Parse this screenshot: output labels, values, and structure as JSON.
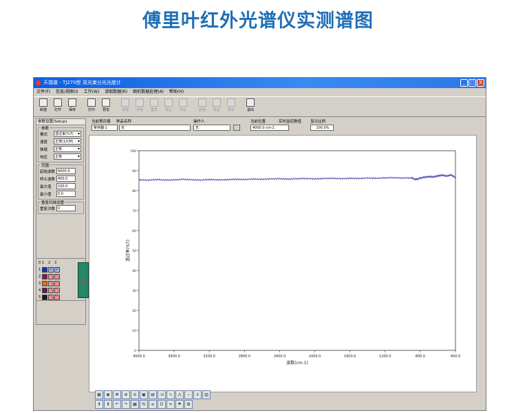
{
  "page": {
    "heading": "傅里叶红外光谱仪实测谱图"
  },
  "window": {
    "title": "天瑞谱 - TJ270型 双光束分光光度计",
    "menu": [
      "文件(F)",
      "信息/视图(I)",
      "工作(W)",
      "读取数据(R)",
      "图形数据处理(A)",
      "帮助(H)"
    ],
    "controls": [
      "_",
      "□",
      "X"
    ]
  },
  "toolbar": {
    "buttons": [
      {
        "label": "新建",
        "icon": "new-file-icon",
        "enabled": true
      },
      {
        "label": "打开",
        "icon": "open-folder-icon",
        "enabled": true
      },
      {
        "label": "保存",
        "icon": "save-icon",
        "enabled": true
      },
      {
        "label": "打印",
        "icon": "print-icon",
        "enabled": true
      },
      {
        "label": "预览",
        "icon": "preview-icon",
        "enabled": true
      },
      {
        "label": "单程",
        "icon": "single-run-icon",
        "enabled": false
      },
      {
        "label": "多程",
        "icon": "multi-run-icon",
        "enabled": false
      },
      {
        "label": "重复",
        "icon": "repeat-icon",
        "enabled": false
      },
      {
        "label": "停止",
        "icon": "stop-icon",
        "enabled": false
      },
      {
        "label": "中止",
        "icon": "abort-icon",
        "enabled": false
      },
      {
        "label": "检测",
        "icon": "detect-icon",
        "enabled": false
      },
      {
        "label": "校正",
        "icon": "calibrate-icon",
        "enabled": false
      },
      {
        "label": "复位",
        "icon": "reset-icon",
        "enabled": false
      },
      {
        "label": "退出",
        "icon": "exit-icon",
        "enabled": true
      }
    ]
  },
  "left_panel": {
    "tab": "参数设置(Setup)",
    "params_title": "参数",
    "params": [
      {
        "label": "模式",
        "value": "透过率(%T)"
      },
      {
        "label": "速度",
        "value": "正常(1/CM)"
      },
      {
        "label": "狭缝",
        "value": "正常"
      },
      {
        "label": "响应",
        "value": "正常"
      }
    ],
    "range_title": "范围",
    "range": [
      {
        "label": "起始波数",
        "value": "4000.0"
      },
      {
        "label": "终止波数",
        "value": "400.0"
      },
      {
        "label": "最大值",
        "value": "100.0"
      },
      {
        "label": "最小值",
        "value": "0.0"
      }
    ],
    "repeat_title": "重复扫描设置",
    "repeat_label": "重复次数",
    "repeat_value": "0"
  },
  "curve_selector": {
    "header": [
      "0",
      "1",
      "2",
      "3"
    ],
    "rows": [
      {
        "n": "1",
        "color": "#1f2fb0",
        "checked": [
          true,
          true
        ]
      },
      {
        "n": "2",
        "color": "#8a1a3a",
        "checked": [
          false,
          false
        ]
      },
      {
        "n": "3",
        "color": "#e07020",
        "checked": [
          false,
          false
        ]
      },
      {
        "n": "4",
        "color": "#6a1a4a",
        "checked": [
          false,
          false
        ]
      },
      {
        "n": "5",
        "color": "#1a1a1a",
        "checked": [
          false,
          false
        ]
      }
    ],
    "arrow_icon": "chevron-right-icon"
  },
  "info_bar": {
    "labels": [
      "当前寄存器",
      "样品名称",
      "操作人",
      "当前位置",
      "实时监控数值",
      "显示比例"
    ],
    "register": "寄存器-1",
    "sample": "无",
    "operator": "无",
    "position": "4000.0 cm-1",
    "ratio": "100.0%"
  },
  "chart_data": {
    "type": "line",
    "xlabel": "波数(cm-1)",
    "ylabel": "透过率(%T)",
    "xlim": [
      4000,
      400
    ],
    "ylim": [
      0,
      100
    ],
    "x_ticks": [
      "4000.0",
      "3600.0",
      "3200.0",
      "2800.0",
      "2400.0",
      "2000.0",
      "1600.0",
      "1200.0",
      "800.0",
      "400.0"
    ],
    "y_ticks": [
      "0",
      "10",
      "20",
      "30",
      "40",
      "50",
      "60",
      "70",
      "80",
      "90",
      "100"
    ],
    "series": [
      {
        "color": "#4a4ab0",
        "x": [
          4000,
          3900,
          3800,
          3700,
          3600,
          3500,
          3400,
          3300,
          3200,
          3100,
          3000,
          2900,
          2800,
          2700,
          2600,
          2500,
          2400,
          2300,
          2200,
          2100,
          2000,
          1900,
          1800,
          1700,
          1600,
          1500,
          1400,
          1300,
          1200,
          1100,
          1000,
          900,
          850,
          800,
          750,
          700,
          650,
          600,
          550,
          500,
          450,
          400
        ],
        "y": [
          85.5,
          85.2,
          85.6,
          85.3,
          85.4,
          85.7,
          85.5,
          85.3,
          85.6,
          85.4,
          85.5,
          85.7,
          85.6,
          85.8,
          85.7,
          85.9,
          86.0,
          85.8,
          86.0,
          86.1,
          85.9,
          86.1,
          86.2,
          86.0,
          86.2,
          86.1,
          86.3,
          86.2,
          86.4,
          86.5,
          86.3,
          86.4,
          85.6,
          86.3,
          86.8,
          87.0,
          86.9,
          87.4,
          87.8,
          87.3,
          87.9,
          86.6
        ]
      }
    ]
  },
  "bottom_tools": {
    "icons": [
      "grid-icon",
      "crosshair-icon",
      "move-icon",
      "zoom-in-icon",
      "zoom-out-icon",
      "full-view-icon",
      "image-icon",
      "export-icon",
      "smooth-icon",
      "peak-icon",
      "baseline-icon",
      "derivative-icon",
      "table-icon",
      "up-arrow-icon",
      "down-arrow-icon",
      "undo-icon",
      "redo-icon",
      "calc-icon",
      "ratio-icon",
      "list-icon",
      "d-icon",
      "delete-icon",
      "mark-icon",
      "copy-icon"
    ],
    "glyphs": [
      "▦",
      "◉",
      "✥",
      "⊕",
      "⊖",
      "▣",
      "▤",
      "⇲",
      "∿",
      "⋀",
      "⎯",
      "∂",
      "▥",
      "⬆",
      "⬇",
      "↶",
      "↷",
      "▦",
      "%",
      "≡",
      "D",
      "✕",
      "⚑",
      "⧉"
    ]
  }
}
